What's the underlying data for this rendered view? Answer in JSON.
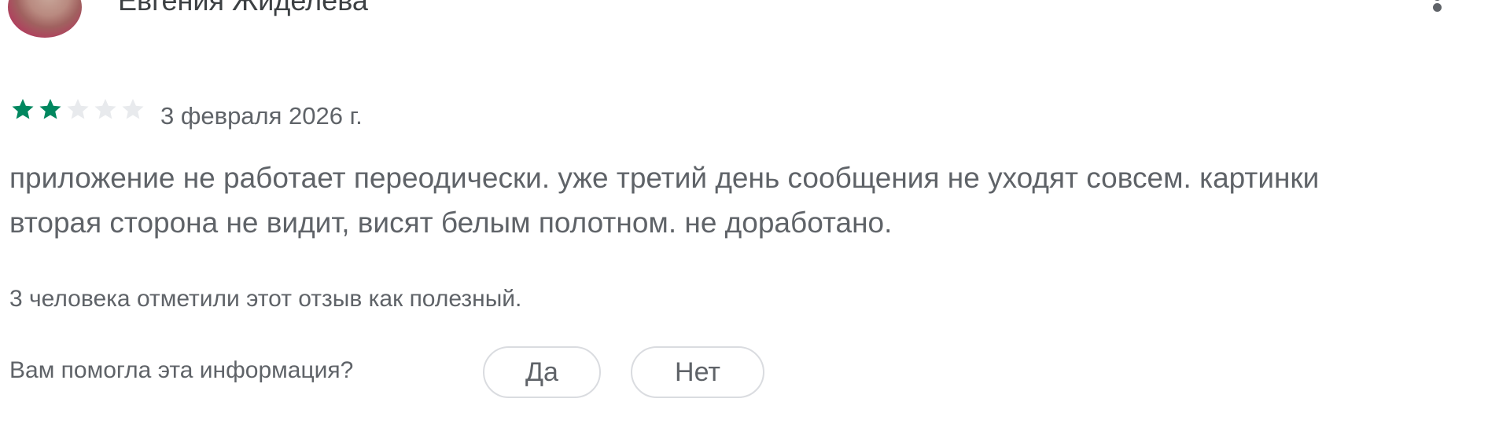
{
  "review": {
    "author_name": "Евгения Жиделева",
    "rating": 2,
    "max_rating": 5,
    "date": "3 февраля 2026 г.",
    "text_lines": [
      "приложение не работает переодически. уже третий день сообщения не уходят совсем. картинки",
      "вторая сторона не видит, висят белым полотном. не доработано."
    ],
    "helpful_count_text": "3 человека отметили этот отзыв как полезный.",
    "helpful_question": "Вам помогла эта информация?",
    "yes_label": "Да",
    "no_label": "Нет"
  },
  "icons": {
    "more": "more-vert-icon",
    "star": "star-icon"
  },
  "colors": {
    "star_filled": "#01875f",
    "star_empty": "#e8eaed",
    "text": "#5f6368",
    "button_border": "#dadce0"
  }
}
